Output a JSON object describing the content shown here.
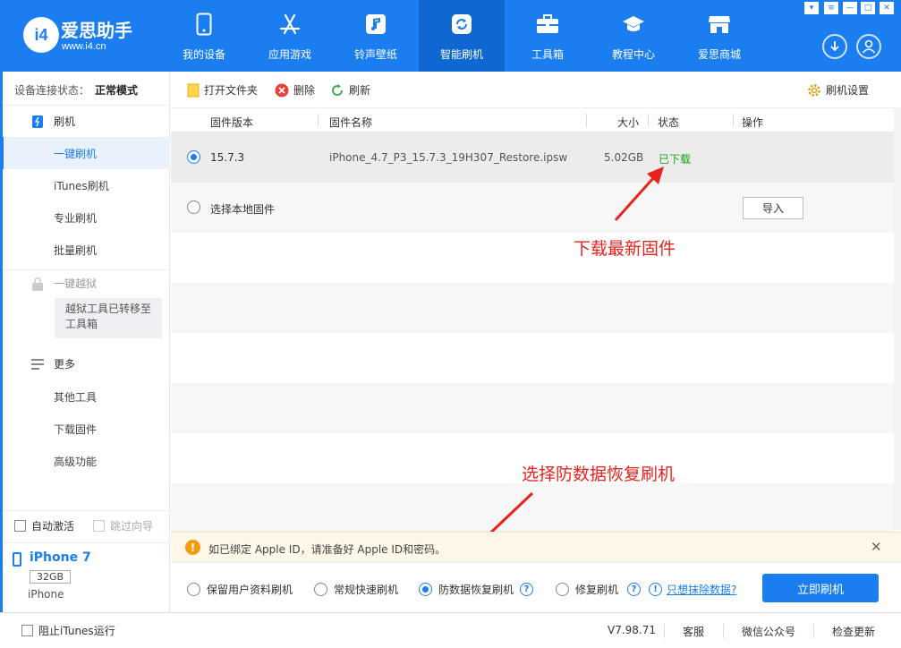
{
  "brand": {
    "logo_text": "i4",
    "name": "爱思助手",
    "url": "www.i4.cn"
  },
  "nav": [
    {
      "label": "我的设备",
      "icon": "phone-icon"
    },
    {
      "label": "应用游戏",
      "icon": "app-store-icon"
    },
    {
      "label": "铃声壁纸",
      "icon": "music-icon"
    },
    {
      "label": "智能刷机",
      "icon": "refresh-icon",
      "active": true
    },
    {
      "label": "工具箱",
      "icon": "toolbox-icon"
    },
    {
      "label": "教程中心",
      "icon": "graduation-cap-icon"
    },
    {
      "label": "爱思商城",
      "icon": "store-icon"
    }
  ],
  "sidebar": {
    "conn_label": "设备连接状态：",
    "conn_value": "正常模式",
    "flash_group": "刷机",
    "flash_items": [
      "一键刷机",
      "iTunes刷机",
      "专业刷机",
      "批量刷机"
    ],
    "jailbreak_group": "一键越狱",
    "jailbreak_note": "越狱工具已转移至工具箱",
    "more_group": "更多",
    "more_items": [
      "其他工具",
      "下载固件",
      "高级功能"
    ],
    "auto_activate": "自动激活",
    "skip_guide": "跳过向导",
    "device_name": "iPhone 7",
    "device_capacity": "32GB",
    "device_model": "iPhone"
  },
  "toolbar": {
    "open_folder": "打开文件夹",
    "delete": "删除",
    "refresh": "刷新",
    "settings": "刷机设置"
  },
  "table": {
    "headers": {
      "version": "固件版本",
      "name": "固件名称",
      "size": "大小",
      "status": "状态",
      "action": "操作"
    },
    "firmware": {
      "version": "15.7.3",
      "name": "iPhone_4.7_P3_15.7.3_19H307_Restore.ipsw",
      "size": "5.02GB",
      "status": "已下载"
    },
    "local": {
      "label": "选择本地固件",
      "import": "导入"
    }
  },
  "annotations": {
    "download": "下载最新固件",
    "select": "选择防数据恢复刷机"
  },
  "notice": {
    "text": "如已绑定 Apple ID，请准备好 Apple ID和密码。"
  },
  "modes": {
    "keep_data": "保留用户资料刷机",
    "quick": "常规快速刷机",
    "anti_recovery": "防数据恢复刷机",
    "repair": "修复刷机",
    "erase_link": "只想抹除数据?",
    "flash_now": "立即刷机"
  },
  "status_bar": {
    "block_itunes": "阻止iTunes运行",
    "version": "V7.98.71",
    "support": "客服",
    "wechat": "微信公众号",
    "update": "检查更新"
  },
  "colors": {
    "brand_blue": "#1a7ef0",
    "annotation_red": "#e8231e",
    "status_green": "#1aa51a"
  }
}
